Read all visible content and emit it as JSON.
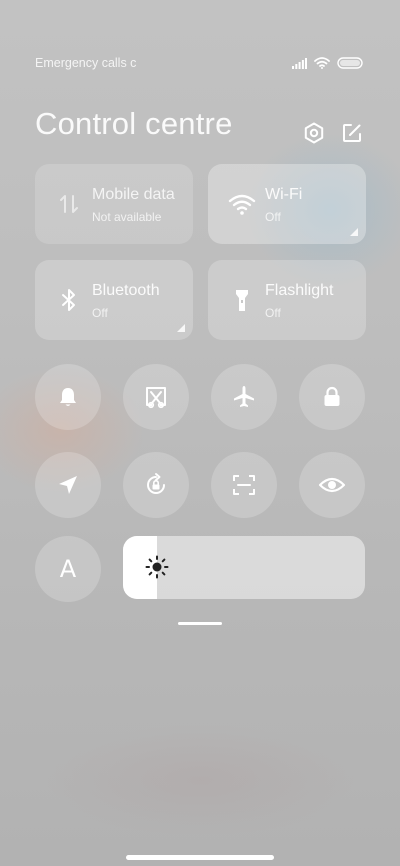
{
  "status_bar": {
    "carrier_text": "Emergency calls c",
    "icons": [
      "signal-icon",
      "wifi-icon",
      "battery-icon"
    ]
  },
  "header": {
    "title": "Control centre",
    "actions": [
      "settings-icon",
      "edit-icon"
    ]
  },
  "tiles": [
    {
      "label": "Mobile data",
      "status": "Not available",
      "icon": "mobile-data-icon"
    },
    {
      "label": "Wi-Fi",
      "status": "Off",
      "icon": "wifi-icon"
    },
    {
      "label": "Bluetooth",
      "status": "Off",
      "icon": "bluetooth-icon"
    },
    {
      "label": "Flashlight",
      "status": "Off",
      "icon": "flashlight-icon"
    }
  ],
  "toggles_row1": [
    "bell-icon",
    "screenshot-icon",
    "airplane-icon",
    "lock-icon"
  ],
  "toggles_row2": [
    "location-icon",
    "rotation-lock-icon",
    "scan-icon",
    "eye-icon"
  ],
  "auto_brightness": {
    "label": "A"
  },
  "brightness": {
    "level_percent": 14,
    "icon": "sun-icon"
  },
  "colors": {
    "text": "#ffffff",
    "slider_track": "#e8e8e8",
    "slider_fill": "#ffffff"
  }
}
